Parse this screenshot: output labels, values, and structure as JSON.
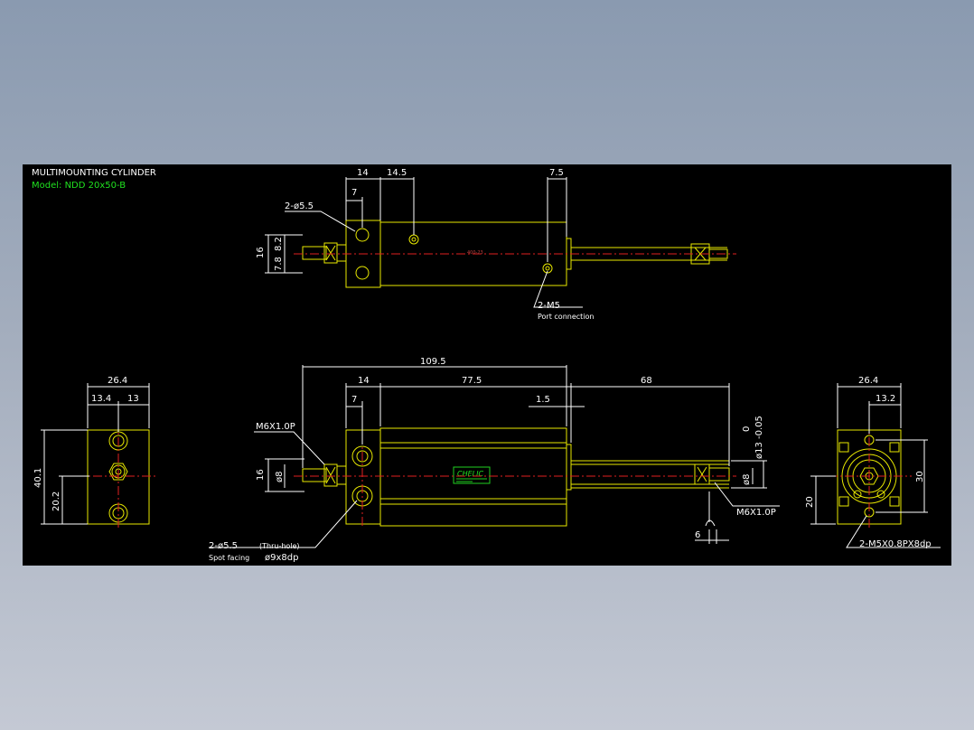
{
  "title": "MULTIMOUNTING CYLINDER",
  "model": "Model: NDD 20x50-B",
  "top_view": {
    "dims": [
      "14",
      "14.5",
      "7.5",
      "7",
      "16",
      "7.8",
      "8.2"
    ],
    "hole_label": "2-ø5.5",
    "port_label": "2-M5",
    "port_note": "Port connection",
    "center_mark": "400-23"
  },
  "front_view": {
    "dims": [
      "109.5",
      "14",
      "77.5",
      "68",
      "7",
      "1.5",
      "16",
      "ø8",
      "ø8",
      "6"
    ],
    "dia_tol": "ø13 -0.05",
    "dia_tol_upper": "0",
    "thread_left": "M6X1.0P",
    "thread_right": "M6X1.0P",
    "hole_label": "2-ø5.5",
    "hole_note": "(Thru-hole)",
    "spot_label": "Spot facing",
    "spot_value": "ø9x8dp",
    "brand": "CHELIC"
  },
  "left_view": {
    "dims": [
      "26.4",
      "13.4",
      "13",
      "40.1",
      "20.2"
    ]
  },
  "right_view": {
    "dims": [
      "26.4",
      "13.2",
      "30",
      "20"
    ],
    "thread_label": "2-M5X0.8PX8dp"
  },
  "colors": {
    "line": "#e8e800",
    "dim": "#ffffff",
    "center": "#e02020",
    "brand": "#20d020",
    "background": "#000000"
  }
}
